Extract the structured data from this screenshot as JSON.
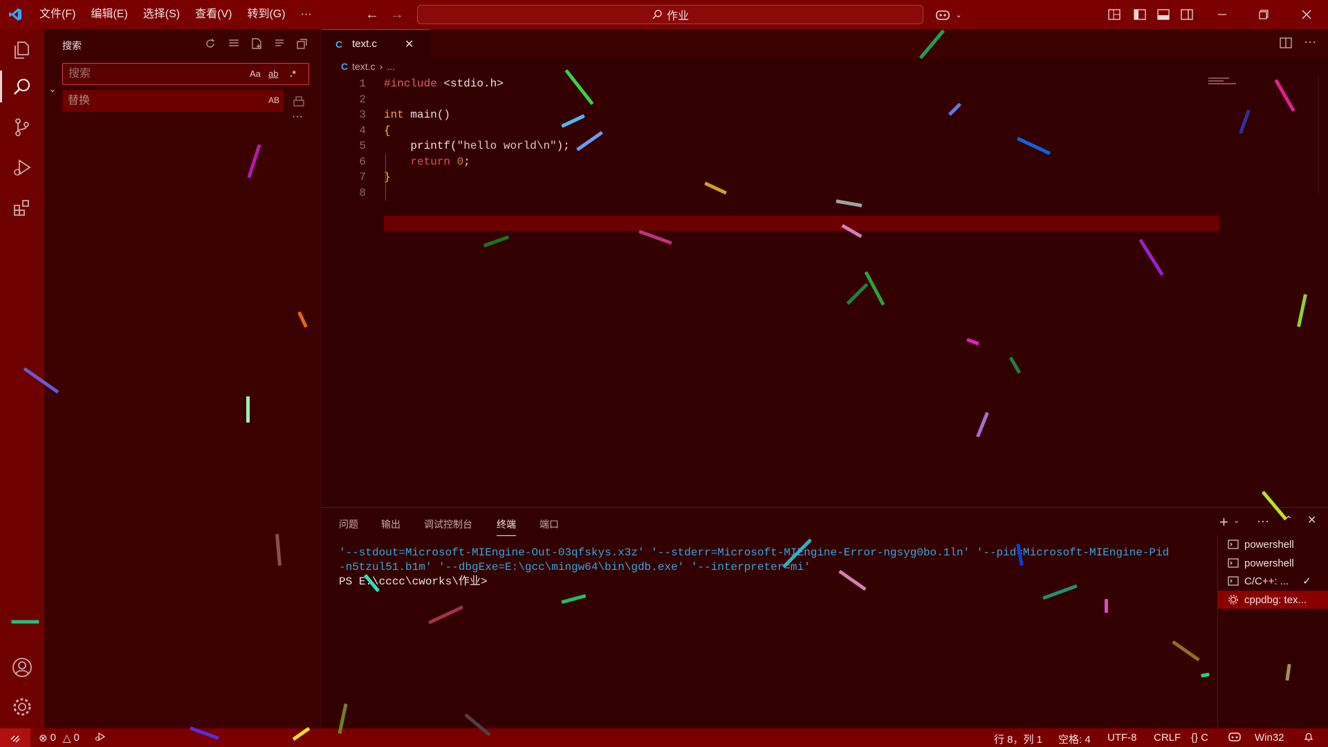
{
  "titlebar": {
    "menus": [
      "文件(F)",
      "编辑(E)",
      "选择(S)",
      "查看(V)",
      "转到(G)",
      "···"
    ],
    "search_text": "作业"
  },
  "sidebar": {
    "title": "搜索",
    "search_placeholder": "搜索",
    "replace_placeholder": "替换",
    "opt_case": "Aa",
    "opt_word": "ab",
    "opt_regex": ".*",
    "opt_preserve": "AB",
    "more": "···"
  },
  "editor": {
    "tab_label": "text.c",
    "tab_lang_icon": "C",
    "breadcrumb_file": "text.c",
    "breadcrumb_more": "...",
    "lines": [
      {
        "n": "1"
      },
      {
        "n": "2"
      },
      {
        "n": "3"
      },
      {
        "n": "4"
      },
      {
        "n": "5"
      },
      {
        "n": "6"
      },
      {
        "n": "7"
      },
      {
        "n": "8"
      }
    ],
    "code": {
      "l1_pp": "#include",
      "l1_rest": " <stdio.h>",
      "l3_kw": "int",
      "l3_rest": " main()",
      "l4": "{",
      "l5_fn": "    printf(",
      "l5_str": "\"hello world\\n\"",
      "l5_end": ");",
      "l6_kw": "    return",
      "l6_num": " 0",
      "l6_end": ";",
      "l7": "}"
    }
  },
  "panel": {
    "tabs": [
      "问题",
      "输出",
      "调试控制台",
      "终端",
      "端口"
    ],
    "active_tab": "终端",
    "terminal_lines": [
      "'--stdout=Microsoft-MIEngine-Out-03qfskys.x3z' '--stderr=Microsoft-MIEngine-Error-ngsyg0bo.1ln' '--pid=Microsoft-MIEngine-Pid",
      "-n5tzul51.b1m' '--dbgExe=E:\\gcc\\mingw64\\bin\\gdb.exe' '--interpreter=mi'"
    ],
    "prompt": "PS E:\\cccc\\cworks\\作业>",
    "terminals": [
      "powershell",
      "powershell",
      "C/C++: ...",
      "cppdbg: tex..."
    ]
  },
  "statusbar": {
    "errors": "0",
    "warnings": "0",
    "position": "行 8，列 1",
    "spaces": "空格: 4",
    "encoding": "UTF-8",
    "eol": "CRLF",
    "lang": "{} C",
    "platform": "Win32"
  },
  "colors": {
    "titlebar": "#7a0000",
    "activitybar": "#6e0000",
    "sidebar": "#3b0000",
    "editor": "#330000",
    "statusbar": "#7a0000",
    "accent": "#cc3333",
    "terminal_blue": "#3aa3e0"
  }
}
